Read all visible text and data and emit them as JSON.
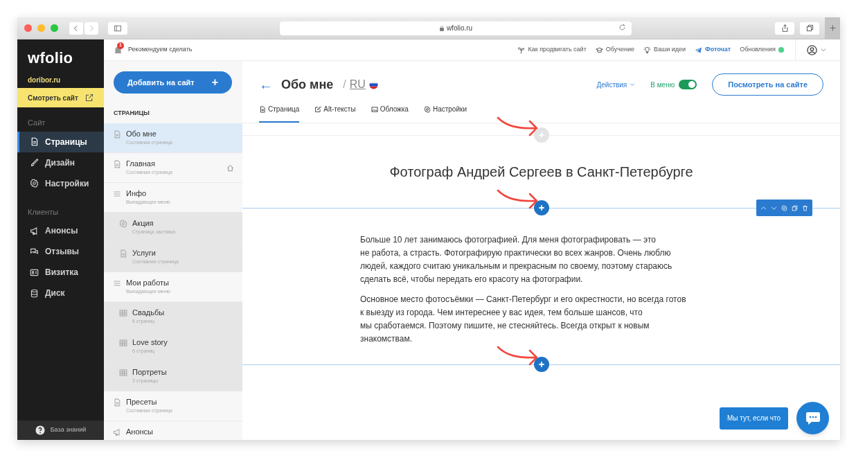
{
  "browser": {
    "address": "wfolio.ru"
  },
  "sidebar": {
    "logo": "wfolio",
    "site_domain": "doribor.ru",
    "view_site": "Смотреть сайт",
    "sections": [
      {
        "title": "Сайт",
        "items": [
          {
            "label": "Страницы",
            "kind": "pages",
            "selected": true
          },
          {
            "label": "Дизайн",
            "kind": "design",
            "selected": false
          },
          {
            "label": "Настройки",
            "kind": "settings",
            "selected": false
          }
        ]
      },
      {
        "title": "Клиенты",
        "items": [
          {
            "label": "Анонсы",
            "kind": "announce",
            "selected": false
          },
          {
            "label": "Отзывы",
            "kind": "reviews",
            "selected": false
          },
          {
            "label": "Визитка",
            "kind": "card",
            "selected": false
          },
          {
            "label": "Диск",
            "kind": "disk",
            "selected": false
          }
        ]
      }
    ],
    "help": "База знаний"
  },
  "topbar": {
    "notifications": {
      "count": "1",
      "label": "Рекомендуем сделать"
    },
    "links": [
      {
        "label": "Как продвигать сайт",
        "kind": "sprout"
      },
      {
        "label": "Обучение",
        "kind": "cap"
      },
      {
        "label": "Ваши идеи",
        "kind": "bulb"
      },
      {
        "label": "Фоточат",
        "kind": "chat"
      },
      {
        "label": "Обновления",
        "kind": "updates"
      }
    ]
  },
  "pages_panel": {
    "add_button": "Добавить на сайт",
    "add_icon": "+",
    "heading": "СТРАНИЦЫ",
    "pages": [
      {
        "title": "Обо мне",
        "subtitle": "Составная страница",
        "kind": "page",
        "selected": true,
        "home": false
      },
      {
        "title": "Главная",
        "subtitle": "Составная страница",
        "kind": "page",
        "selected": false,
        "home": true
      },
      {
        "title": "Инфо",
        "subtitle": "Выпадающее меню",
        "kind": "menu",
        "selected": false,
        "home": false,
        "children": [
          {
            "title": "Акция",
            "subtitle": "Страница заставка",
            "kind": "splash",
            "selected": false,
            "home": false
          },
          {
            "title": "Услуги",
            "subtitle": "Составная страница",
            "kind": "page",
            "selected": false,
            "home": false
          }
        ]
      },
      {
        "title": "Мои работы",
        "subtitle": "Выпадающее меню",
        "kind": "menu",
        "selected": false,
        "home": false,
        "children": [
          {
            "title": "Свадьбы",
            "subtitle": "6 страниц",
            "kind": "gallery",
            "selected": false,
            "home": false
          },
          {
            "title": "Love story",
            "subtitle": "6 страниц",
            "kind": "gallery",
            "selected": false,
            "home": false
          },
          {
            "title": "Портреты",
            "subtitle": "3 страницы",
            "kind": "gallery",
            "selected": false,
            "home": false
          }
        ]
      },
      {
        "title": "Пресеты",
        "subtitle": "Составная страница",
        "kind": "page",
        "selected": false,
        "home": false
      },
      {
        "title": "Анонсы",
        "kind": "announce",
        "selected": false,
        "home": false
      }
    ]
  },
  "editor": {
    "back": "←",
    "title": "Обо мне",
    "separator": "/",
    "language": "RU",
    "actions": "Действия",
    "in_menu": {
      "label": "В меню",
      "on": true
    },
    "view_button": "Посмотреть на сайте",
    "tabs": [
      {
        "label": "Страница",
        "kind": "page",
        "selected": true
      },
      {
        "label": "Alt-тексты",
        "kind": "edit",
        "selected": false
      },
      {
        "label": "Обложка",
        "kind": "image",
        "selected": false
      },
      {
        "label": "Настройки",
        "kind": "settings",
        "selected": false
      }
    ],
    "blocks": [
      {
        "kind": "add",
        "active": false
      },
      {
        "kind": "heading",
        "text": "Фотограф Андрей Сергеев в Санкт-Петербурге"
      },
      {
        "kind": "add",
        "active": true
      },
      {
        "kind": "text",
        "paragraphs": [
          "Больше 10 лет занимаюсь фотографией. Для меня фотографировать — это\nне работа, а страсть. Фотографирую практически во всех жанров. Очень люблю\nлюдей, каждого считаю уникальным и прекрасным по своему, поэтому стараюсь\nсделать всё, чтобы передать его красоту на фотографии.",
          "Основное место фотосъёмки — Санкт-Петербург и его окрестности, но всегда готов\nк выезду из города. Чем интереснее у вас идея, тем больше шансов, что\nмы сработаемся. Поэтому пишите, не стесняйтесь. Всегда открыт к новым\nзнакомствам."
        ]
      },
      {
        "kind": "add",
        "active": true
      }
    ],
    "chat_prompt": "Мы тут, если что"
  }
}
